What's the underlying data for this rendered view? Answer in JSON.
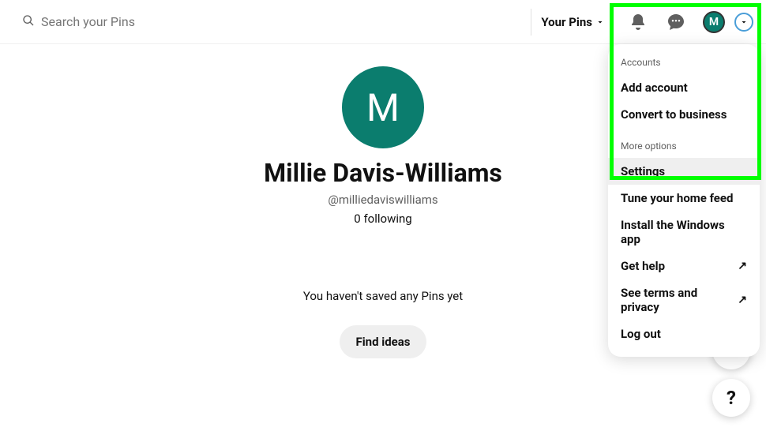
{
  "header": {
    "search_placeholder": "Search your Pins",
    "your_pins_label": "Your Pins",
    "avatar_initial": "M"
  },
  "profile": {
    "avatar_initial": "M",
    "name": "Millie Davis-Williams",
    "username": "@milliedaviswilliams",
    "following": "0 following",
    "no_pins_text": "You haven't saved any Pins yet",
    "find_ideas_label": "Find ideas"
  },
  "menu": {
    "accounts_label": "Accounts",
    "add_account": "Add account",
    "convert_business": "Convert to business",
    "more_options_label": "More options",
    "settings": "Settings",
    "tune_feed": "Tune your home feed",
    "install_windows": "Install the Windows app",
    "get_help": "Get help",
    "see_terms": "See terms and privacy",
    "log_out": "Log out"
  },
  "fab": {
    "plus": "+",
    "help": "?"
  }
}
